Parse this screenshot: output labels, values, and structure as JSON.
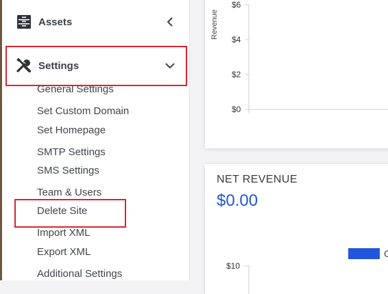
{
  "sidebar": {
    "assets_label": "Assets",
    "settings_label": "Settings",
    "submenu": [
      "General Settings",
      "Set Custom Domain",
      "Set Homepage",
      "SMTP Settings",
      "SMS Settings",
      "Team & Users",
      "Delete Site",
      "Import XML",
      "Export XML",
      "Additional Settings"
    ]
  },
  "highlight_color": "#d9232d",
  "revenue_chart": {
    "chart_data": {
      "type": "bar",
      "ylabel": "Revenue",
      "yticks": [
        "$0",
        "$2",
        "$4",
        "$6"
      ],
      "ylim": [
        0,
        6
      ],
      "values": []
    }
  },
  "net_revenue": {
    "title": "NET REVENUE",
    "value": "$0.00",
    "chart_data": {
      "type": "bar",
      "ytick_top": "$10",
      "legend_color": "#2255dd",
      "legend_label_partial": "C",
      "values": []
    }
  }
}
